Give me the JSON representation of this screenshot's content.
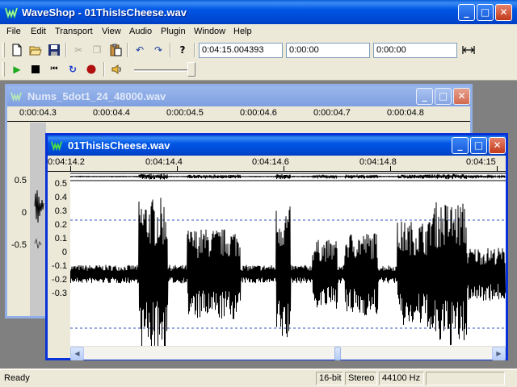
{
  "app": {
    "title": "WaveShop - 01ThisIsCheese.wav"
  },
  "menu": [
    "File",
    "Edit",
    "Transport",
    "View",
    "Audio",
    "Plugin",
    "Window",
    "Help"
  ],
  "toolbar": {
    "position_value": "0:04:15.004393",
    "selection_start_value": "0:00:00",
    "selection_length_value": "0:00:00",
    "icons": {
      "new": "new-document-icon",
      "open": "open-folder-icon",
      "save": "save-disk-icon",
      "cut": "cut-scissors-icon",
      "copy": "copy-icon",
      "paste": "paste-clipboard-icon",
      "undo": "undo-icon",
      "redo": "redo-icon",
      "help": "help-icon",
      "fit": "fit-width-icon",
      "play": "play-icon",
      "stop": "stop-icon",
      "rewind": "rewind-icon",
      "loop": "loop-icon",
      "record": "record-icon",
      "volume": "speaker-icon"
    },
    "volume_level": 0.9
  },
  "windows": {
    "back": {
      "title": "Nums_5dot1_24_48000.wav",
      "ruler_labels": [
        "0:00:04.3",
        "0:00:04.4",
        "0:00:04.5",
        "0:00:04.6",
        "0:00:04.7",
        "0:00:04.8"
      ],
      "y_labels": [
        "0.5",
        "0",
        "-0.5"
      ]
    },
    "front": {
      "title": "01ThisIsCheese.wav",
      "ruler_labels": [
        "0:04:14.2",
        "0:04:14.4",
        "0:04:14.6",
        "0:04:14.8",
        "0:04:15"
      ],
      "y_labels": [
        "0.5",
        "0.4",
        "0.3",
        "0.2",
        "0.1",
        "0",
        "-0.1",
        "-0.2",
        "-0.3"
      ]
    }
  },
  "colors": {
    "title_blue": "#0055e5",
    "waveform": "#000000",
    "guide_line": "#3050c0",
    "window_face": "#ece9d8"
  },
  "status": {
    "ready": "Ready",
    "bit_depth": "16-bit",
    "channels": "Stereo",
    "sample_rate": "44100 Hz"
  }
}
